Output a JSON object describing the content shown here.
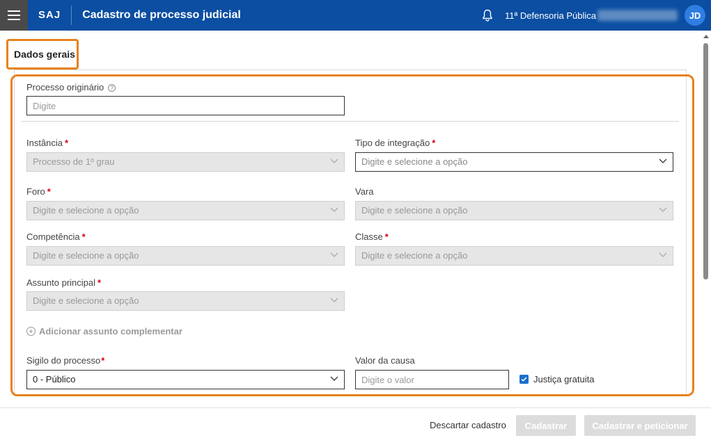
{
  "header": {
    "logo": "SAJ",
    "title": "Cadastro de processo judicial",
    "unit": "11ª Defensoria Pública",
    "avatar_initials": "JD",
    "brand_color": "#0b4ea2"
  },
  "section": {
    "title": "Dados gerais"
  },
  "form": {
    "processo_originario": {
      "label": "Processo originário",
      "placeholder": "Digite"
    },
    "instancia": {
      "label": "Instância",
      "required": "*",
      "value": "Processo de 1º grau"
    },
    "tipo_integracao": {
      "label": "Tipo de integração",
      "required": "*",
      "placeholder": "Digite e selecione a opção"
    },
    "foro": {
      "label": "Foro",
      "required": "*",
      "placeholder": "Digite e selecione a opção"
    },
    "vara": {
      "label": "Vara",
      "placeholder": "Digite e selecione a opção"
    },
    "competencia": {
      "label": "Competência",
      "required": "*",
      "placeholder": "Digite e selecione a opção"
    },
    "classe": {
      "label": "Classe",
      "required": "*",
      "placeholder": "Digite e selecione a opção"
    },
    "assunto_principal": {
      "label": "Assunto principal",
      "required": "*",
      "placeholder": "Digite e selecione a opção"
    },
    "add_assunto": "Adicionar assunto complementar",
    "sigilo": {
      "label": "Sigilo do processo",
      "required": "*",
      "value": "0 - Público"
    },
    "valor_causa": {
      "label": "Valor da causa",
      "placeholder": "Digite o valor"
    },
    "justica_gratuita": {
      "label": "Justiça gratuita",
      "checked": true
    }
  },
  "footer": {
    "discard": "Descartar cadastro",
    "submit": "Cadastrar",
    "submit_petition": "Cadastrar e peticionar"
  },
  "highlight_color": "#e8821c"
}
